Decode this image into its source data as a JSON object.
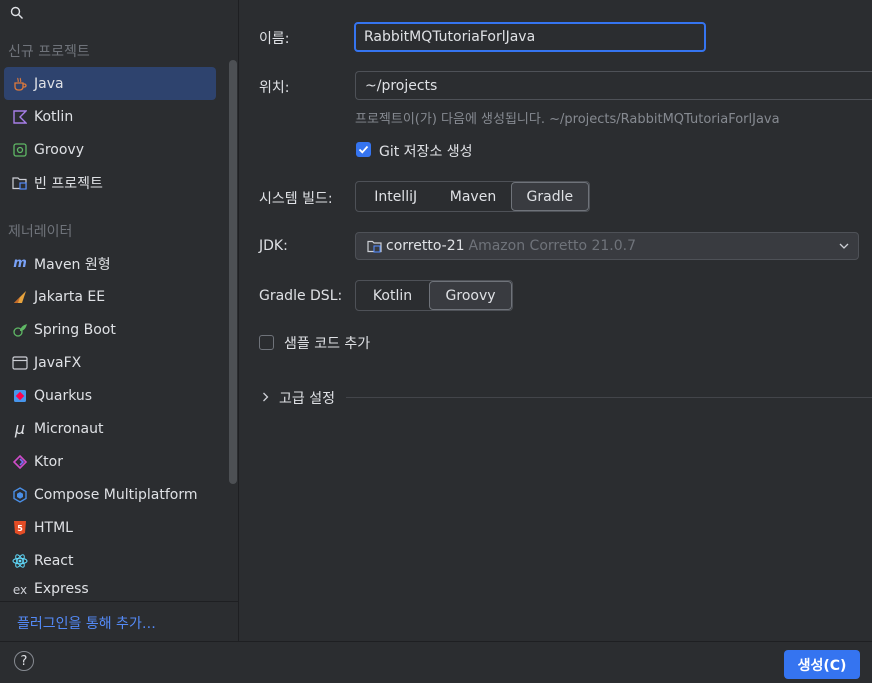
{
  "sidebar": {
    "section_new": "신규 프로젝트",
    "new_items": [
      {
        "label": "Java",
        "icon": "java-cup-icon"
      },
      {
        "label": "Kotlin",
        "icon": "kotlin-icon"
      },
      {
        "label": "Groovy",
        "icon": "groovy-icon"
      },
      {
        "label": "빈 프로젝트",
        "icon": "empty-project-icon"
      }
    ],
    "section_generators": "제너레이터",
    "generator_items": [
      {
        "label": "Maven 원형",
        "icon": "maven-archetype-icon"
      },
      {
        "label": "Jakarta EE",
        "icon": "jakarta-ee-icon"
      },
      {
        "label": "Spring Boot",
        "icon": "spring-boot-icon"
      },
      {
        "label": "JavaFX",
        "icon": "javafx-icon"
      },
      {
        "label": "Quarkus",
        "icon": "quarkus-icon"
      },
      {
        "label": "Micronaut",
        "icon": "micronaut-icon"
      },
      {
        "label": "Ktor",
        "icon": "ktor-icon"
      },
      {
        "label": "Compose Multiplatform",
        "icon": "compose-icon"
      },
      {
        "label": "HTML",
        "icon": "html5-icon"
      },
      {
        "label": "React",
        "icon": "react-icon"
      },
      {
        "label": "Express",
        "icon": "express-icon"
      }
    ],
    "plugin_link": "플러그인을 통해 추가…"
  },
  "form": {
    "name_label": "이름:",
    "name_value": "RabbitMQTutoriaForlJava",
    "location_label": "위치:",
    "location_value": "~/projects",
    "location_hint": "프로젝트이(가) 다음에 생성됩니다. ~/projects/RabbitMQTutoriaForlJava",
    "git_label": "Git 저장소 생성",
    "git_checked": true,
    "build_label": "시스템 빌드:",
    "build_options": [
      "IntelliJ",
      "Maven",
      "Gradle"
    ],
    "build_selected": "Gradle",
    "jdk_label": "JDK:",
    "jdk_name": "corretto-21",
    "jdk_detail": "Amazon Corretto 21.0.7",
    "dsl_label": "Gradle DSL:",
    "dsl_options": [
      "Kotlin",
      "Groovy"
    ],
    "dsl_selected": "Groovy",
    "sample_label": "샘플 코드 추가",
    "sample_checked": false,
    "advanced_label": "고급 설정"
  },
  "footer": {
    "help_label": "?",
    "create_label": "생성(C)"
  },
  "colors": {
    "background": "#2b2d30",
    "accent": "#3574f0",
    "selection": "#2e436e",
    "link": "#548af7"
  }
}
